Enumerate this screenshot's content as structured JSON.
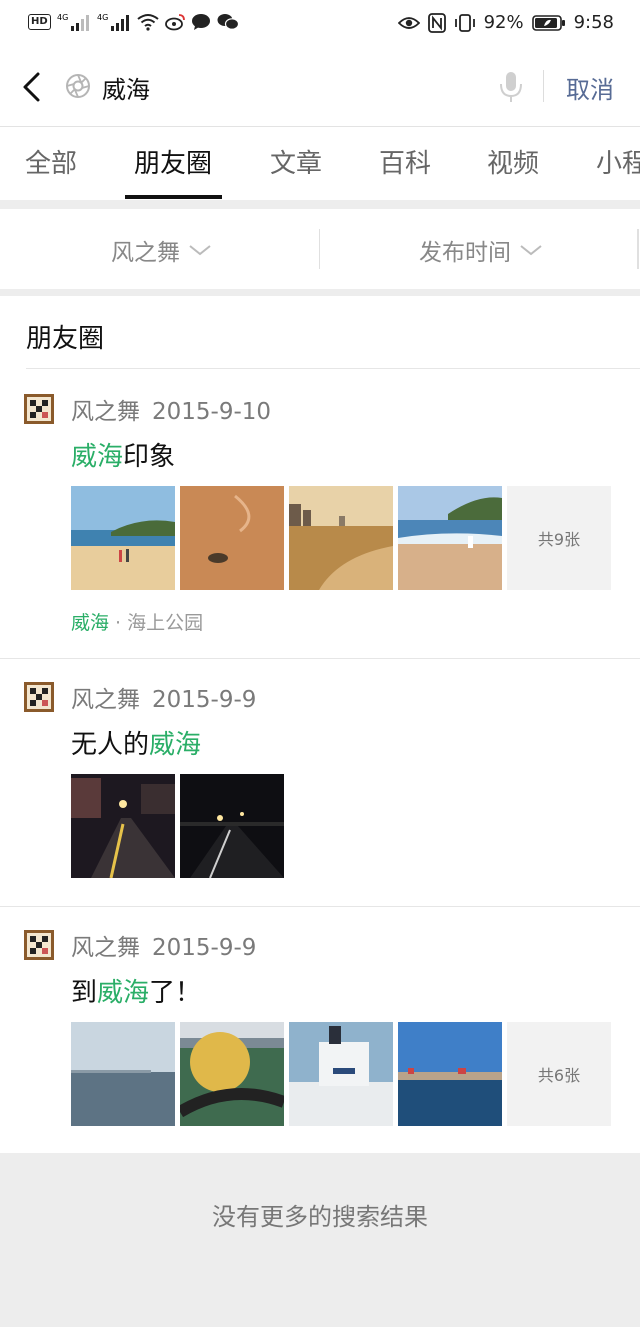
{
  "status": {
    "network_left": "4G",
    "network_right": "4G",
    "battery": "92%",
    "time": "9:58"
  },
  "search": {
    "query": "威海",
    "cancel_label": "取消"
  },
  "tabs": [
    {
      "label": "全部"
    },
    {
      "label": "朋友圈"
    },
    {
      "label": "文章"
    },
    {
      "label": "百科"
    },
    {
      "label": "视频"
    },
    {
      "label": "小程"
    }
  ],
  "filters": {
    "author": "风之舞",
    "time": "发布时间"
  },
  "section": {
    "title": "朋友圈"
  },
  "posts": [
    {
      "author": "风之舞",
      "date": "2015-9-10",
      "text_pre": "",
      "text_hl": "威海",
      "text_post": "印象",
      "more_label": "共9张",
      "location_hl": "威海",
      "location_rest": " · 海上公园"
    },
    {
      "author": "风之舞",
      "date": "2015-9-9",
      "text_pre": "无人的",
      "text_hl": "威海",
      "text_post": ""
    },
    {
      "author": "风之舞",
      "date": "2015-9-9",
      "text_pre": "到",
      "text_hl": "威海",
      "text_post": "了！",
      "more_label": "共6张"
    }
  ],
  "footer": {
    "no_more": "没有更多的搜索结果"
  },
  "colors": {
    "highlight": "#2aae67",
    "cancel": "#576b95"
  }
}
